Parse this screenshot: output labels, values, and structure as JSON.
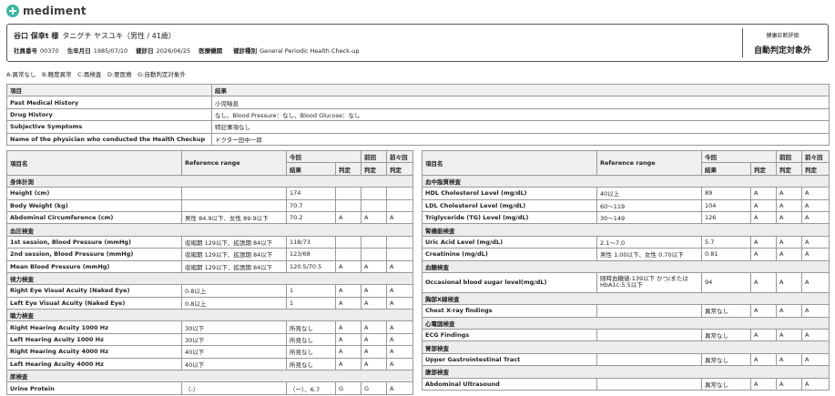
{
  "brand": {
    "name": "mediment"
  },
  "patient": {
    "name": "谷口 保幸t 様",
    "kana": "タニグチ ヤスユキ（男性 / 41歳）",
    "fields": [
      {
        "label": "社員番号",
        "value": "00370"
      },
      {
        "label": "生年月日",
        "value": "1985/07/10"
      },
      {
        "label": "健診日",
        "value": "2026/06/25"
      },
      {
        "label": "医療機関",
        "value": ""
      },
      {
        "label": "健診種別",
        "value": "General Periodic Health Check-up"
      }
    ]
  },
  "evaluation": {
    "label": "健康診断評価",
    "value": "自動判定対象外"
  },
  "legend": "A:異常なし　B:軽度異常　C:再検査　D:要医療　G:自動判定対象外",
  "history": {
    "headers": [
      "項目",
      "結果"
    ],
    "rows": [
      {
        "item": "Past Medical History",
        "result": "小児喘息"
      },
      {
        "item": "Drug History",
        "result": "なし、Blood Pressure：なし、Blood Glucose：なし"
      },
      {
        "item": "Subjective Symptoms",
        "result": "特記事項なし"
      },
      {
        "item": "Name of the physician who conducted the Health Checkup",
        "result": "ドクター田中一郎"
      }
    ]
  },
  "results_headers": {
    "item": "項目名",
    "reference": "Reference range",
    "current": "今回",
    "previous": "前回",
    "before_previous": "前々回",
    "result": "結果",
    "judgment": "判定"
  },
  "left_sections": [
    {
      "title": "身体計測",
      "rows": [
        {
          "item": "Height (cm)",
          "ref": "",
          "result": "174",
          "j": "",
          "p": "",
          "pp": ""
        },
        {
          "item": "Body Weight (kg)",
          "ref": "",
          "result": "70.7",
          "j": "",
          "p": "",
          "pp": ""
        },
        {
          "item": "Abdominal Circumference (cm)",
          "ref": "男性 84.9以下、女性 89.9以下",
          "result": "70.2",
          "j": "A",
          "p": "A",
          "pp": "A"
        }
      ]
    },
    {
      "title": "血圧検査",
      "rows": [
        {
          "item": "1st session, Blood Pressure (mmHg)",
          "ref": "収縮期 129以下、拡張期 84以下",
          "result": "118/73",
          "j": "",
          "p": "",
          "pp": ""
        },
        {
          "item": "2nd session, Blood Pressure (mmHg)",
          "ref": "収縮期 129以下、拡張期 84以下",
          "result": "123/68",
          "j": "",
          "p": "",
          "pp": ""
        },
        {
          "item": "Mean Blood Pressure (mmHg)",
          "ref": "収縮期 129以下、拡張期 84以下",
          "result": "120.5/70.5",
          "j": "A",
          "p": "A",
          "pp": "A"
        }
      ]
    },
    {
      "title": "視力検査",
      "rows": [
        {
          "item": "Right Eye Visual Acuity (Naked Eye)",
          "ref": "0.8以上",
          "result": "1",
          "j": "A",
          "p": "A",
          "pp": "A"
        },
        {
          "item": "Left Eye Visual Acuity (Naked Eye)",
          "ref": "0.8以上",
          "result": "1",
          "j": "A",
          "p": "A",
          "pp": "A"
        }
      ]
    },
    {
      "title": "聴力検査",
      "rows": [
        {
          "item": "Right Hearing Acuity 1000 Hz",
          "ref": "30以下",
          "result": "所見なし",
          "j": "A",
          "p": "A",
          "pp": "A"
        },
        {
          "item": "Left Hearing Acuity 1000 Hz",
          "ref": "30以下",
          "result": "所見なし",
          "j": "A",
          "p": "A",
          "pp": "A"
        },
        {
          "item": "Right Hearing Acuity 4000 Hz",
          "ref": "40以下",
          "result": "所見なし",
          "j": "A",
          "p": "A",
          "pp": "A"
        },
        {
          "item": "Left Hearing Acuity 4000 Hz",
          "ref": "40以下",
          "result": "所見なし",
          "j": "A",
          "p": "A",
          "pp": "A"
        }
      ]
    },
    {
      "title": "尿検査",
      "rows": [
        {
          "item": "Urine Protein",
          "ref": "（-）",
          "result": "（ー）、6.7",
          "j": "G",
          "p": "G",
          "pp": "A"
        }
      ]
    }
  ],
  "right_sections": [
    {
      "title": "血中脂質検査",
      "rows": [
        {
          "item": "HDL Cholesterol Level (mg/dL)",
          "ref": "40以上",
          "result": "89",
          "j": "A",
          "p": "A",
          "pp": "A"
        },
        {
          "item": "LDL Cholesterol Level (mg/dL)",
          "ref": "60〜119",
          "result": "104",
          "j": "A",
          "p": "A",
          "pp": "A"
        },
        {
          "item": "Triglyceride (TG) Level (mg/dL)",
          "ref": "30〜149",
          "result": "126",
          "j": "A",
          "p": "A",
          "pp": "A"
        }
      ]
    },
    {
      "title": "腎機能検査",
      "rows": [
        {
          "item": "Uric Acid Level (mg/dL)",
          "ref": "2.1〜7.0",
          "result": "5.7",
          "j": "A",
          "p": "A",
          "pp": "A"
        },
        {
          "item": "Creatinine (mg/dL)",
          "ref": "男性 1.00以下、女性 0.70以下",
          "result": "0.81",
          "j": "A",
          "p": "A",
          "pp": "A"
        }
      ]
    },
    {
      "title": "血糖検査",
      "rows": [
        {
          "item": "Occasional blood sugar level(mg/dL)",
          "ref": "随時血糖値:139以下 かつ/または HbA1c:5.5以下",
          "result": "94",
          "j": "A",
          "p": "A",
          "pp": "A",
          "wrap": true
        }
      ]
    },
    {
      "title": "胸部X線検査",
      "rows": [
        {
          "item": "Chest X-ray findings",
          "ref": "",
          "result": "異常なし",
          "j": "A",
          "p": "A",
          "pp": "A"
        }
      ]
    },
    {
      "title": "心電図検査",
      "rows": [
        {
          "item": "ECG Findings",
          "ref": "",
          "result": "異常なし",
          "j": "A",
          "p": "A",
          "pp": "A"
        }
      ]
    },
    {
      "title": "胃部検査",
      "rows": [
        {
          "item": "Upper Gastrointestinal Tract",
          "ref": "",
          "result": "異常なし",
          "j": "A",
          "p": "A",
          "pp": "A"
        }
      ]
    },
    {
      "title": "腹部検査",
      "rows": [
        {
          "item": "Abdominal Ultrasound",
          "ref": "",
          "result": "異常なし",
          "j": "A",
          "p": "A",
          "pp": "A"
        }
      ]
    }
  ]
}
